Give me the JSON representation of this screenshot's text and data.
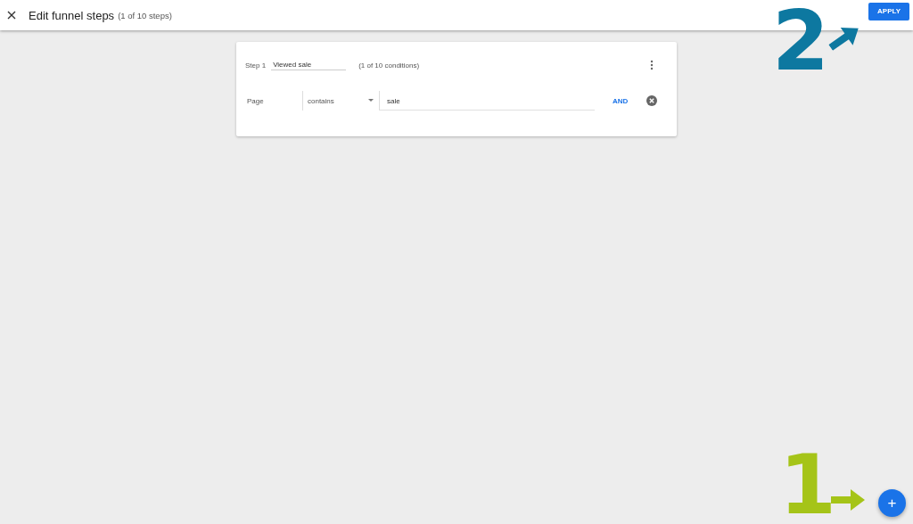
{
  "header": {
    "title": "Edit funnel steps",
    "subtitle": "(1 of 10 steps)",
    "apply_button": "APPLY"
  },
  "steps": [
    {
      "label": "Step 1",
      "name": "Viewed sale",
      "count": "(1 of 10 conditions)",
      "conditions": [
        {
          "dimension": "Page",
          "operator": "contains",
          "value": "sale",
          "connector": "AND"
        }
      ]
    }
  ],
  "annotations": [
    {
      "label": "2",
      "color": "#0d78a0",
      "kind": "apply"
    },
    {
      "label": "1",
      "color": "#a5c418",
      "kind": "add"
    }
  ],
  "add_button": "+"
}
